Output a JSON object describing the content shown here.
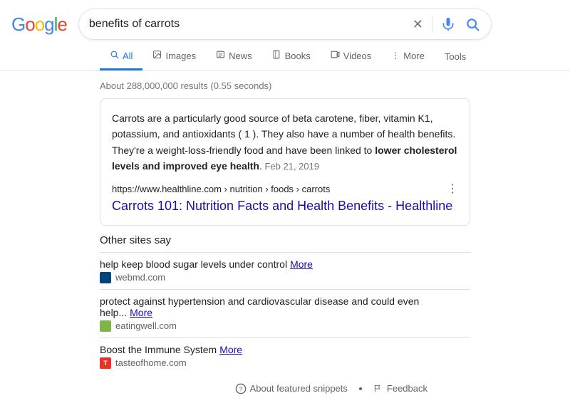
{
  "header": {
    "logo_letters": [
      "G",
      "o",
      "o",
      "g",
      "l",
      "e"
    ],
    "search_query": "benefits of carrots",
    "clear_icon": "×",
    "mic_icon": "🎤",
    "search_icon": "🔍"
  },
  "nav": {
    "tabs": [
      {
        "id": "all",
        "label": "All",
        "icon": "🔍",
        "active": true
      },
      {
        "id": "images",
        "label": "Images",
        "icon": "🖼",
        "active": false
      },
      {
        "id": "news",
        "label": "News",
        "icon": "📰",
        "active": false
      },
      {
        "id": "books",
        "label": "Books",
        "icon": "📖",
        "active": false
      },
      {
        "id": "videos",
        "label": "Videos",
        "icon": "▶",
        "active": false
      },
      {
        "id": "more",
        "label": "More",
        "icon": "⋮",
        "active": false
      }
    ],
    "tools_label": "Tools"
  },
  "results": {
    "stats": "About 288,000,000 results (0.55 seconds)",
    "featured_snippet": {
      "text_before_bold": "Carrots are a particularly good source of beta carotene, fiber, vitamin K1, potassium, and antioxidants ( 1 ). They also have a number of health benefits. They're a weight-loss-friendly food and have been linked to ",
      "bold_text": "lower cholesterol levels and improved eye health",
      "text_after_bold": ".",
      "date": " Feb 21, 2019",
      "url": "https://www.healthline.com › nutrition › foods › carrots",
      "link_text": "Carrots 101: Nutrition Facts and Health Benefits - Healthline"
    },
    "other_sites": {
      "title": "Other sites say",
      "items": [
        {
          "snippet": "help keep blood sugar levels under control",
          "more_label": "More",
          "source": "webmd.com",
          "favicon_class": "favicon-webmd"
        },
        {
          "snippet": "protect against hypertension and cardiovascular disease and could even help...",
          "more_label": "More",
          "source": "eatingwell.com",
          "favicon_class": "favicon-eatingwell"
        },
        {
          "snippet": "Boost the Immune System",
          "more_label": "More",
          "source": "tasteofhome.com",
          "favicon_class": "favicon-taste",
          "favicon_text": "T"
        }
      ]
    },
    "footer": {
      "about_label": "About featured snippets",
      "feedback_label": "Feedback"
    }
  }
}
